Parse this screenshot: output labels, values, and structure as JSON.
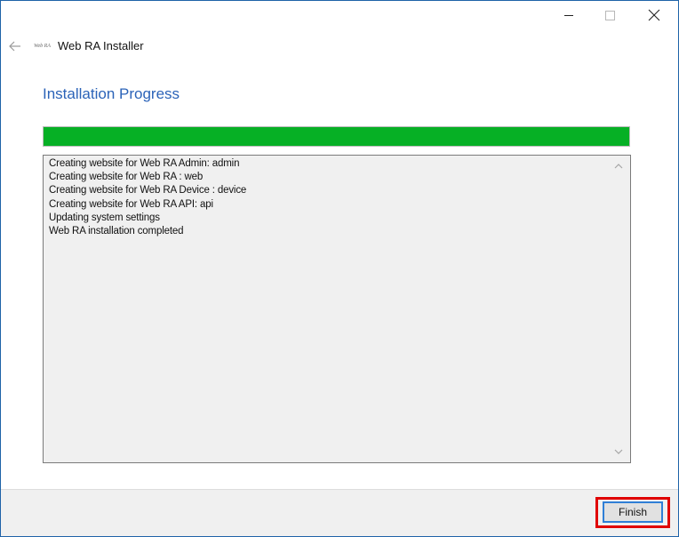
{
  "window": {
    "title": "Web RA  Installer",
    "logo_text": "Web RA"
  },
  "page": {
    "heading": "Installation Progress"
  },
  "progress": {
    "percent": 100,
    "color": "#06b025"
  },
  "log": {
    "lines": [
      "Creating website for Web RA Admin: admin",
      "Creating website for Web RA : web",
      "Creating website for Web RA Device : device",
      "Creating website for Web RA API: api",
      "Updating system settings",
      "Web RA installation completed"
    ]
  },
  "footer": {
    "finish_label": "Finish"
  },
  "colors": {
    "accent": "#2b63b8",
    "highlight": "#e00000"
  },
  "icons": {
    "back": "back-arrow-icon",
    "minimize": "minimize-icon",
    "maximize": "maximize-icon",
    "close": "close-icon",
    "scroll_up": "chevron-up-icon",
    "scroll_down": "chevron-down-icon"
  }
}
